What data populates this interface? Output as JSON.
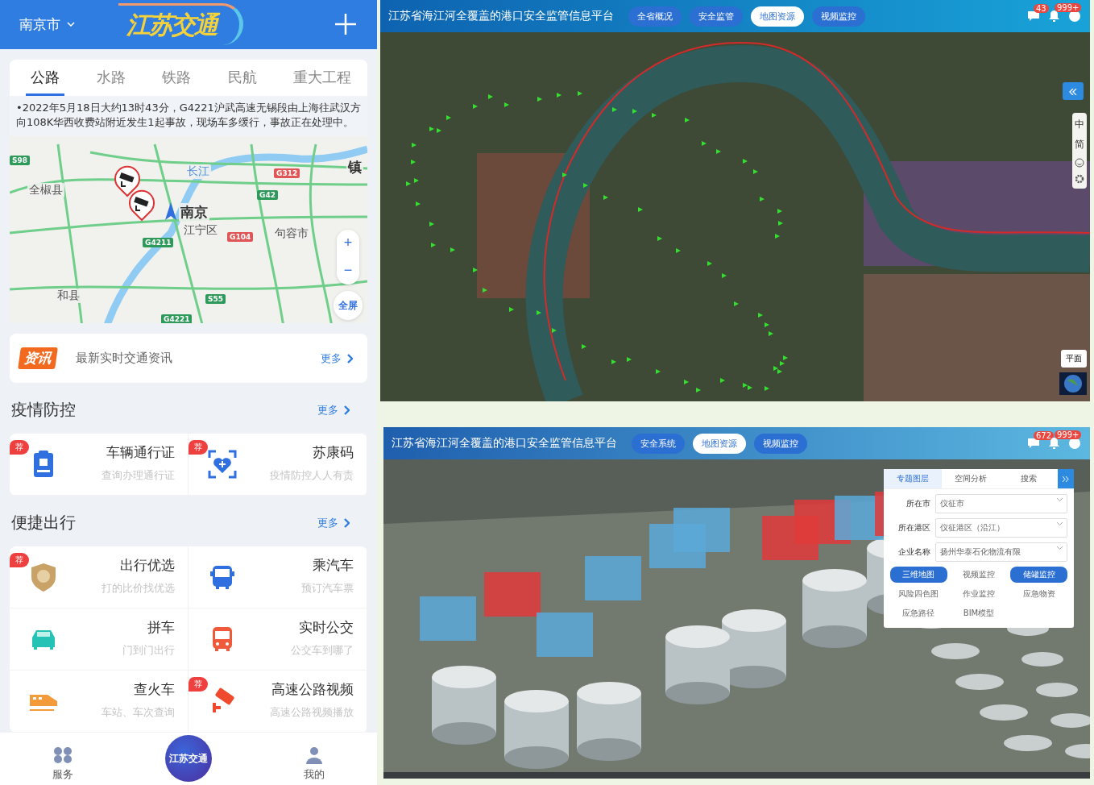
{
  "mobile": {
    "city": "南京市",
    "logo": "江苏交通",
    "tabs": [
      {
        "label": "公路",
        "selected": true
      },
      {
        "label": "水路",
        "selected": false
      },
      {
        "label": "铁路",
        "selected": false
      },
      {
        "label": "民航",
        "selected": false
      },
      {
        "label": "重大工程",
        "selected": false
      }
    ],
    "notice": "•2022年5月18日大约13时43分，G4221沪武高速无锡段由上海往武汉方向108K华西收费站附近发生1起事故，现场车多缓行，事故正在处理中。",
    "map": {
      "labels": [
        {
          "text": "S98",
          "kind": "highway"
        },
        {
          "text": "长江",
          "kind": "river"
        },
        {
          "text": "G312",
          "kind": "national"
        },
        {
          "text": "镇",
          "kind": "city"
        },
        {
          "text": "全椒县",
          "kind": "place"
        },
        {
          "text": "G42",
          "kind": "highway"
        },
        {
          "text": "南京",
          "kind": "city"
        },
        {
          "text": "江宁区",
          "kind": "place"
        },
        {
          "text": "G104",
          "kind": "national"
        },
        {
          "text": "句容市",
          "kind": "place"
        },
        {
          "text": "G4211",
          "kind": "highway"
        },
        {
          "text": "和县",
          "kind": "place"
        },
        {
          "text": "S55",
          "kind": "highway"
        },
        {
          "text": "G4221",
          "kind": "highway"
        }
      ],
      "zoom_in": "+",
      "zoom_out": "−",
      "fullscreen": "全屏"
    },
    "news": {
      "badge": "资讯",
      "text": "最新实时交通资讯",
      "more": "更多"
    },
    "sections": [
      {
        "title": "疫情防控",
        "more": "更多",
        "items": [
          {
            "title": "车辆通行证",
            "subtitle": "查询办理通行证",
            "badge": "荐"
          },
          {
            "title": "苏康码",
            "subtitle": "疫情防控人人有责",
            "badge": "荐"
          }
        ]
      },
      {
        "title": "便捷出行",
        "more": "更多",
        "items": [
          {
            "title": "出行优选",
            "subtitle": "打的比价找优选",
            "badge": "荐"
          },
          {
            "title": "乘汽车",
            "subtitle": "预订汽车票"
          },
          {
            "title": "拼车",
            "subtitle": "门到门出行"
          },
          {
            "title": "实时公交",
            "subtitle": "公交车到哪了"
          },
          {
            "title": "查火车",
            "subtitle": "车站、车次查询"
          },
          {
            "title": "高速公路视频",
            "subtitle": "高速公路视频播放",
            "badge": "荐"
          }
        ]
      }
    ],
    "bottom_nav": [
      {
        "label": "服务"
      },
      {
        "label": "江苏交通"
      },
      {
        "label": "我的"
      }
    ]
  },
  "web_map": {
    "title": "江苏省海江河全覆盖的港口安全监管信息平台",
    "nav": [
      {
        "label": "全省概况",
        "selected": false
      },
      {
        "label": "安全监管",
        "selected": false
      },
      {
        "label": "地图资源",
        "selected": true
      },
      {
        "label": "视频监控",
        "selected": false
      }
    ],
    "badges": [
      "43",
      "999+"
    ],
    "side_tools": [
      "中",
      "简"
    ],
    "view_toggle": "平面"
  },
  "web_3d": {
    "title": "江苏省海江河全覆盖的港口安全监管信息平台",
    "nav": [
      {
        "label": "安全系统",
        "selected": false
      },
      {
        "label": "地图资源",
        "selected": true
      },
      {
        "label": "视频监控",
        "selected": false
      }
    ],
    "badges": [
      "672",
      "999+"
    ],
    "panel": {
      "tabs": [
        {
          "label": "专题图层",
          "selected": true
        },
        {
          "label": "空间分析",
          "selected": false
        },
        {
          "label": "搜索",
          "selected": false
        }
      ],
      "fields": [
        {
          "label": "所在市",
          "value": "仪征市"
        },
        {
          "label": "所在港区",
          "value": "仪征港区（沿江）"
        },
        {
          "label": "企业名称",
          "value": "扬州华泰石化物流有限"
        }
      ],
      "layers": [
        {
          "label": "三维地图",
          "selected": true
        },
        {
          "label": "视频监控",
          "selected": false
        },
        {
          "label": "储罐监控",
          "selected": true
        },
        {
          "label": "风险四色图",
          "selected": false
        },
        {
          "label": "作业监控",
          "selected": false
        },
        {
          "label": "应急物资",
          "selected": false
        },
        {
          "label": "应急路径",
          "selected": false
        },
        {
          "label": "BIM模型",
          "selected": false
        }
      ]
    }
  }
}
